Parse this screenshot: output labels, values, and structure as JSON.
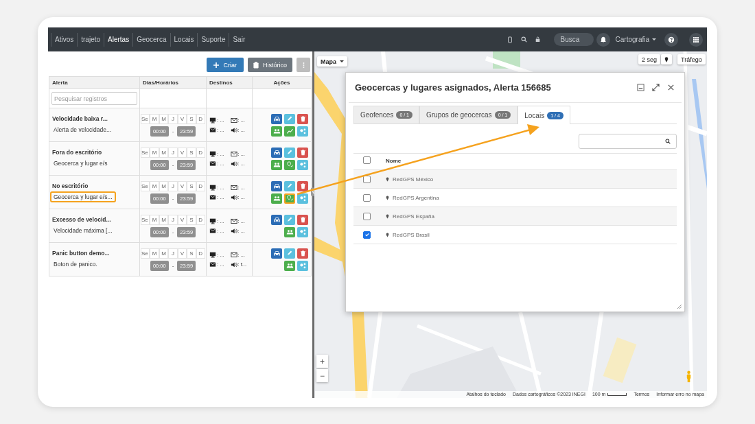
{
  "nav": {
    "items": [
      {
        "label": "Ativos",
        "selected": false
      },
      {
        "label": "trajeto",
        "selected": false
      },
      {
        "label": "Alertas",
        "selected": true
      },
      {
        "label": "Geocerca",
        "selected": false
      },
      {
        "label": "Locais",
        "selected": false
      },
      {
        "label": "Suporte",
        "selected": false
      },
      {
        "label": "Sair",
        "selected": false
      }
    ],
    "search_placeholder": "Busca",
    "map_menu": "Cartografia"
  },
  "toolbar": {
    "buttons": [
      {
        "kind": "create",
        "label": "Criar"
      },
      {
        "kind": "history",
        "label": "Histórico"
      },
      {
        "kind": "more"
      }
    ]
  },
  "table": {
    "columns": [
      "Alerta",
      "Dias/Horários",
      "Destinos",
      "Ações"
    ],
    "search": {
      "placeholder": "Pesquisar registros"
    },
    "rows": [
      {
        "title": "Velocidade baixa r...",
        "subtitle": "Alerta de velocidade...",
        "highlighted": false,
        "days": [
          "Se",
          "M",
          "M",
          "J",
          "V",
          "S",
          "D"
        ],
        "start": "00:00",
        "time_separator": "-",
        "end": "23:59",
        "destinations": [
          ": ...",
          ": ...",
          ": ...",
          ": ..."
        ],
        "actions": {
          "top": [
            {
              "kind": "vehicles",
              "highlighted": false
            },
            {
              "kind": "edit",
              "highlighted": false
            },
            {
              "kind": "delete",
              "highlighted": false
            }
          ],
          "bottom": [
            {
              "kind": "contacts",
              "highlighted": false
            },
            {
              "kind": "trend",
              "highlighted": false
            },
            {
              "kind": "settings",
              "highlighted": false
            }
          ]
        }
      },
      {
        "title": "Fora do escritório",
        "subtitle": "Geocerca y lugar e/s",
        "highlighted": false,
        "days": [
          "Se",
          "M",
          "M",
          "J",
          "V",
          "S",
          "D"
        ],
        "start": "00:00",
        "time_separator": "-",
        "end": "23:59",
        "destinations": [
          ": ...",
          ": ...",
          ": ...",
          ": ..."
        ],
        "actions": {
          "top": [
            {
              "kind": "vehicles",
              "highlighted": false
            },
            {
              "kind": "edit",
              "highlighted": false
            },
            {
              "kind": "delete",
              "highlighted": false
            }
          ],
          "bottom": [
            {
              "kind": "contacts",
              "highlighted": false
            },
            {
              "kind": "places",
              "highlighted": false
            },
            {
              "kind": "settings",
              "highlighted": false
            }
          ]
        }
      },
      {
        "title": "No escritório",
        "subtitle": "Geocerca y lugar e/s...",
        "highlighted": true,
        "days": [
          "Se",
          "M",
          "M",
          "J",
          "V",
          "S",
          "D"
        ],
        "start": "00:00",
        "time_separator": "-",
        "end": "23:59",
        "destinations": [
          ": ...",
          ": ...",
          ": ...",
          ": ..."
        ],
        "actions": {
          "top": [
            {
              "kind": "vehicles",
              "highlighted": false
            },
            {
              "kind": "edit",
              "highlighted": false
            },
            {
              "kind": "delete",
              "highlighted": false
            }
          ],
          "bottom": [
            {
              "kind": "contacts",
              "highlighted": false
            },
            {
              "kind": "places",
              "highlighted": true
            },
            {
              "kind": "settings",
              "highlighted": false
            }
          ]
        }
      },
      {
        "title": "Excesso de velocid...",
        "subtitle": "Velocidade máxima [...",
        "highlighted": false,
        "days": [
          "Se",
          "M",
          "M",
          "J",
          "V",
          "S",
          "D"
        ],
        "start": "00:00",
        "time_separator": "-",
        "end": "23:59",
        "destinations": [
          ": ...",
          ": ...",
          ": ...",
          ": ..."
        ],
        "actions": {
          "top": [
            {
              "kind": "vehicles",
              "highlighted": false
            },
            {
              "kind": "edit",
              "highlighted": false
            },
            {
              "kind": "delete",
              "highlighted": false
            }
          ],
          "bottom": [
            {
              "kind": "contacts",
              "highlighted": false
            },
            {
              "kind": "settings",
              "highlighted": false
            }
          ]
        }
      },
      {
        "title": "Panic button demo...",
        "subtitle": "Boton de panico.",
        "highlighted": false,
        "days": [
          "Se",
          "M",
          "M",
          "J",
          "V",
          "S",
          "D"
        ],
        "start": "00:00",
        "time_separator": "-",
        "end": "23:59",
        "destinations": [
          ": ...",
          ": ...",
          ": ...",
          ": f..."
        ],
        "actions": {
          "top": [
            {
              "kind": "vehicles",
              "highlighted": false
            },
            {
              "kind": "edit",
              "highlighted": false
            },
            {
              "kind": "delete",
              "highlighted": false
            }
          ],
          "bottom": [
            {
              "kind": "contacts",
              "highlighted": false
            },
            {
              "kind": "settings",
              "highlighted": false
            }
          ]
        }
      }
    ]
  },
  "map": {
    "type_menu": "Mapa",
    "refresh": "2 seg",
    "traffic": "Tráfego",
    "zoom_in": "+",
    "zoom_out": "−",
    "attribution": [
      "Atalhos do teclado",
      "Dados cartográficos ©2023 INEGI",
      "100 m",
      "Termos",
      "Informar erro no mapa"
    ]
  },
  "modal": {
    "title": "Geocercas y lugares asignados, Alerta 156685",
    "tabs": [
      {
        "label": "Geofences",
        "count": "0 / 1",
        "selected": false
      },
      {
        "label": "Grupos de geocercas",
        "count": "0 / 1",
        "selected": false
      },
      {
        "label": "Locais",
        "count": "1 / 4",
        "selected": true
      }
    ],
    "columns": [
      "Nome"
    ],
    "select_all_checked": false,
    "rows": [
      {
        "name": "RedGPS México",
        "checked": false
      },
      {
        "name": "RedGPS Argentina",
        "checked": false
      },
      {
        "name": "RedGPS España",
        "checked": false
      },
      {
        "name": "RedGPS Brasil",
        "checked": true
      }
    ]
  }
}
